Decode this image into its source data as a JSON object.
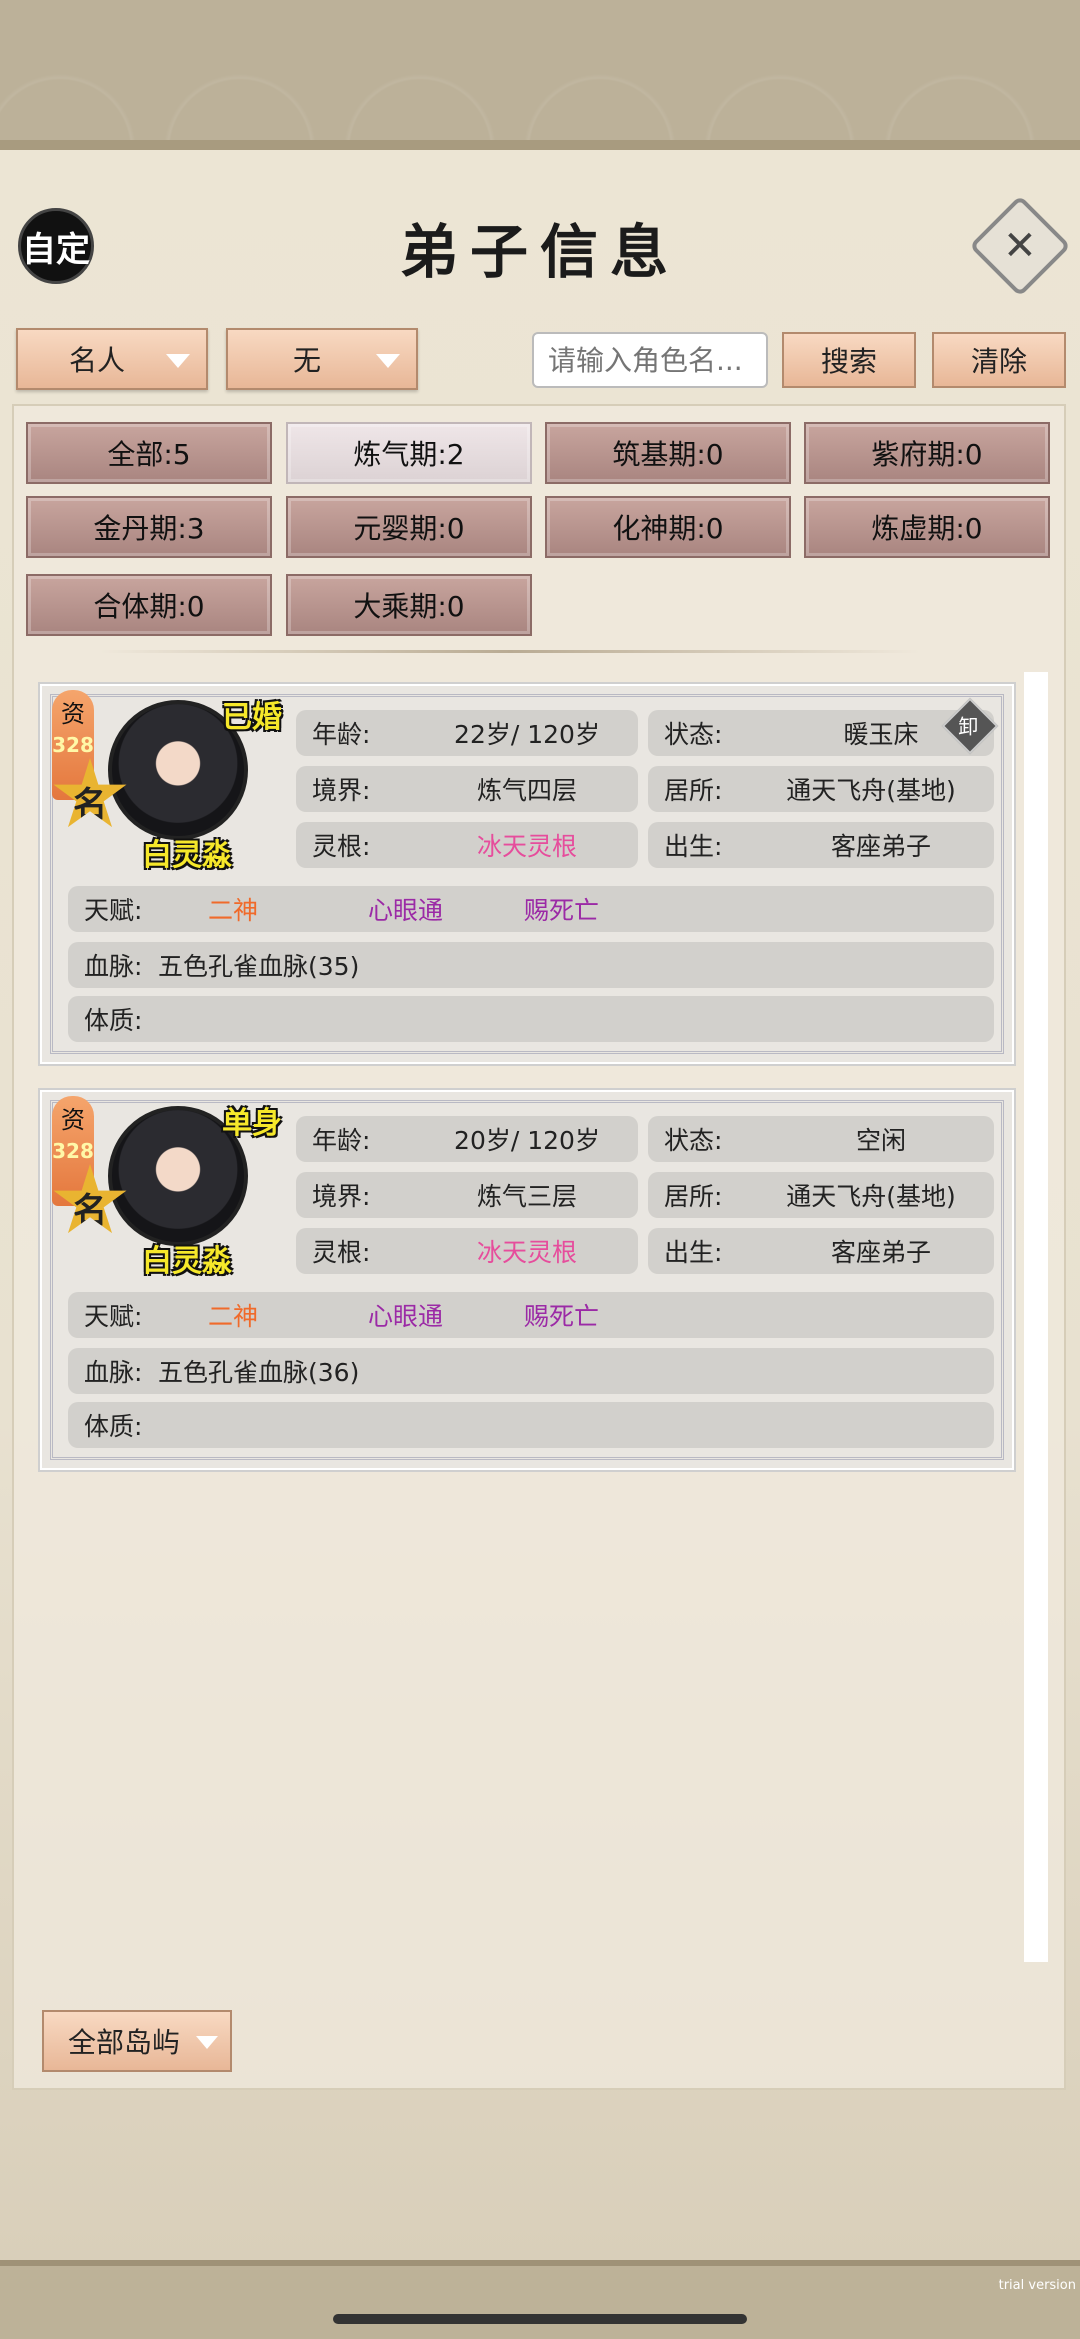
{
  "header": {
    "custom_label": "自定",
    "title": "弟子信息",
    "close_icon": "close-icon"
  },
  "filters": {
    "type_dropdown": "名人",
    "sub_dropdown": "无",
    "search_placeholder": "请输入角色名...",
    "search_button": "搜索",
    "clear_button": "清除"
  },
  "realms": [
    "全部:5",
    "炼气期:2",
    "筑基期:0",
    "紫府期:0",
    "金丹期:3",
    "元婴期:0",
    "化神期:0",
    "炼虚期:0",
    "合体期:0",
    "大乘期:0"
  ],
  "active_realm": "炼气期:2",
  "labels": {
    "age": "年龄:",
    "status": "状态:",
    "realm": "境界:",
    "residence": "居所:",
    "root": "灵根:",
    "origin": "出生:",
    "talent": "天赋:",
    "bloodline": "血脉:",
    "physique": "体质:",
    "zi": "资",
    "ming": "名",
    "unload": "卸"
  },
  "disciples": [
    {
      "name": "白灵淼",
      "marital": "已婚",
      "aptitude": "328",
      "age": "22岁/ 120岁",
      "status": "暖玉床",
      "realm": "炼气四层",
      "residence": "通天飞舟(基地)",
      "root": "冰天灵根",
      "origin": "客座弟子",
      "talents": [
        "二神",
        "心眼通",
        "赐死亡"
      ],
      "bloodline": "五色孔雀血脉(35)",
      "physique": ""
    },
    {
      "name": "白灵淼",
      "marital": "单身",
      "aptitude": "328",
      "age": "20岁/ 120岁",
      "status": "空闲",
      "realm": "炼气三层",
      "residence": "通天飞舟(基地)",
      "root": "冰天灵根",
      "origin": "客座弟子",
      "talents": [
        "二神",
        "心眼通",
        "赐死亡"
      ],
      "bloodline": "五色孔雀血脉(36)",
      "physique": ""
    }
  ],
  "island_dropdown": "全部岛屿",
  "watermark": "trial version",
  "colors": {
    "root": "#e64d9c",
    "talent_1": "#f06a2a",
    "talent_2": "#9b2aa6",
    "name_yellow": "#f6e82a"
  }
}
